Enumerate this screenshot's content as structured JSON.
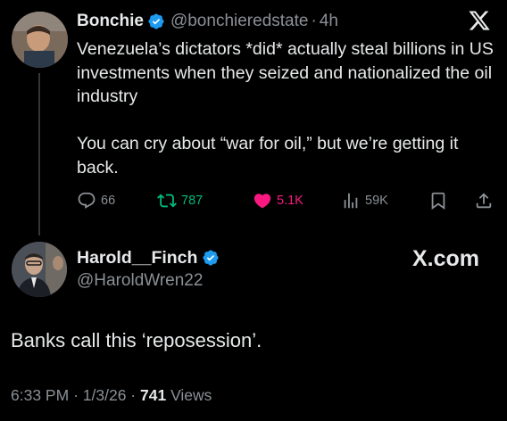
{
  "parent_tweet": {
    "author_name": "Bonchie",
    "handle": "@bonchieredstate",
    "separator": "·",
    "time": "4h",
    "paragraphs": [
      "Venezuela’s dictators *did* actually steal billions in US investments when they seized and nationalized the oil industry",
      "You can cry about “war for oil,” but we’re getting it back."
    ],
    "actions": {
      "replies": "66",
      "reposts": "787",
      "likes": "5.1K",
      "views": "59K"
    },
    "accent_colors": {
      "repost": "#00ba7c",
      "like": "#f91880",
      "verified": "#1d9bf0"
    }
  },
  "main_tweet": {
    "author_name": "Harold__Finch",
    "handle": "@HaroldWren22",
    "watermark": "X.com",
    "text": "Banks call this ‘reposession’.",
    "time": "6:33 PM",
    "separator": "·",
    "date": "1/3/26",
    "views_count": "741",
    "views_label": " Views"
  },
  "icons": [
    "verified-badge-icon",
    "x-logo-icon",
    "reply-icon",
    "repost-icon",
    "like-icon",
    "views-icon",
    "bookmark-icon",
    "share-icon"
  ]
}
